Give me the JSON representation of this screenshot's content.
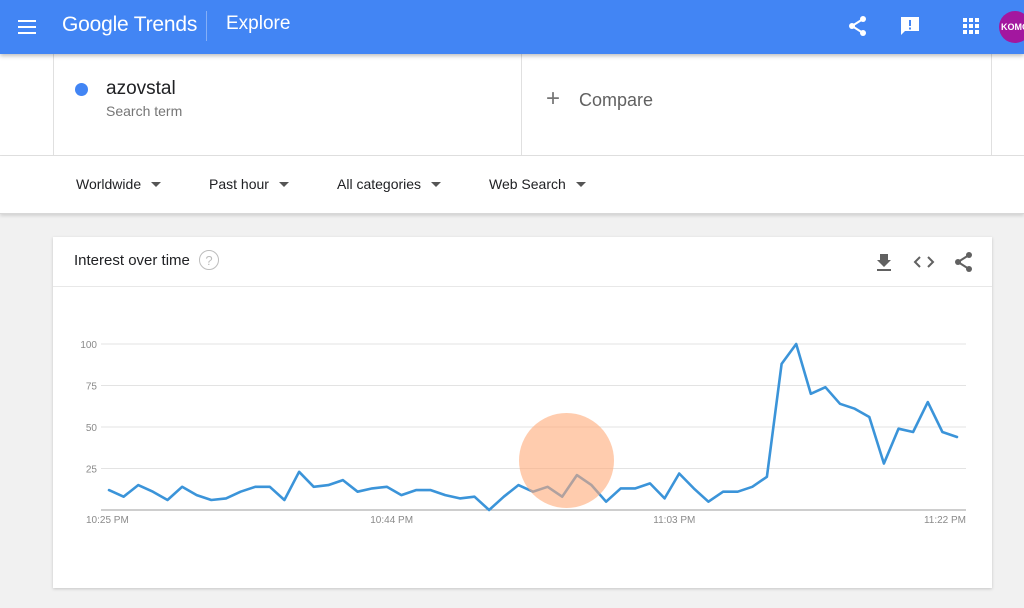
{
  "header": {
    "logo_text": "Google Trends",
    "page_title": "Explore",
    "avatar_text": "KOMO"
  },
  "search": {
    "term": "azovstal",
    "term_sub": "Search term",
    "compare_label": "Compare"
  },
  "filters": {
    "region": "Worldwide",
    "time": "Past hour",
    "category": "All categories",
    "search_type": "Web Search"
  },
  "card": {
    "title": "Interest over time"
  },
  "colors": {
    "appbar": "#4285f4",
    "series": "#3b94d9",
    "avatar": "#a3179f"
  },
  "chart_data": {
    "type": "line",
    "title": "",
    "xlabel": "",
    "ylabel": "",
    "ylim": [
      0,
      100
    ],
    "yticks": [
      "100",
      "75",
      "50",
      "25"
    ],
    "xtick_labels": [
      "10:25 PM",
      "10:44 PM",
      "11:03 PM",
      "11:22 PM"
    ],
    "grid": true,
    "legend": "none",
    "series": [
      {
        "values": [
          12,
          8,
          15,
          11,
          6,
          14,
          9,
          6,
          7,
          11,
          14,
          14,
          6,
          23,
          14,
          15,
          18,
          11,
          13,
          14,
          9,
          12,
          12,
          9,
          7,
          8,
          0,
          8,
          15,
          11,
          14,
          8,
          21,
          15,
          5,
          13,
          13,
          16,
          7,
          22,
          13,
          5,
          11,
          11,
          14,
          20,
          88,
          100,
          70,
          74,
          64,
          61,
          56,
          28,
          49,
          47,
          65,
          47,
          44
        ]
      }
    ]
  }
}
